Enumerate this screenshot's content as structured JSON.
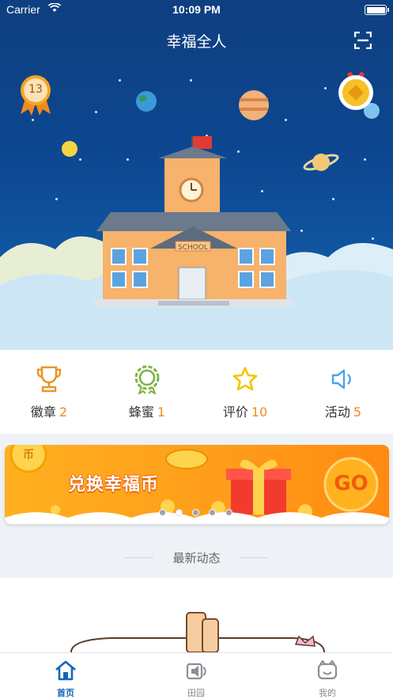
{
  "status_bar": {
    "carrier": "Carrier",
    "time": "10:09 PM"
  },
  "header": {
    "title": "幸福全人",
    "scan_icon": "scan-icon"
  },
  "hero": {
    "level_badge": "13"
  },
  "stats": [
    {
      "label": "徽章",
      "count": "2",
      "icon": "trophy-icon"
    },
    {
      "label": "蜂蜜",
      "count": "1",
      "icon": "gear-medal-icon"
    },
    {
      "label": "评价",
      "count": "10",
      "icon": "star-icon"
    },
    {
      "label": "活动",
      "count": "5",
      "icon": "speaker-icon"
    }
  ],
  "banner": {
    "text": "兑换幸福币",
    "coin_label": "币",
    "go_label": "GO",
    "slide_count": 5,
    "active_slide": 2
  },
  "news": {
    "title": "最新动态"
  },
  "tabbar": [
    {
      "label": "首页",
      "icon": "home-icon",
      "active": true
    },
    {
      "label": "田园",
      "icon": "speaker-tab-icon",
      "active": false
    },
    {
      "label": "我的",
      "icon": "profile-icon",
      "active": false
    }
  ],
  "colors": {
    "accent": "#1565c0",
    "count": "#f08a1c",
    "sky": "#0d4791",
    "banner": "#ff9d1a"
  }
}
